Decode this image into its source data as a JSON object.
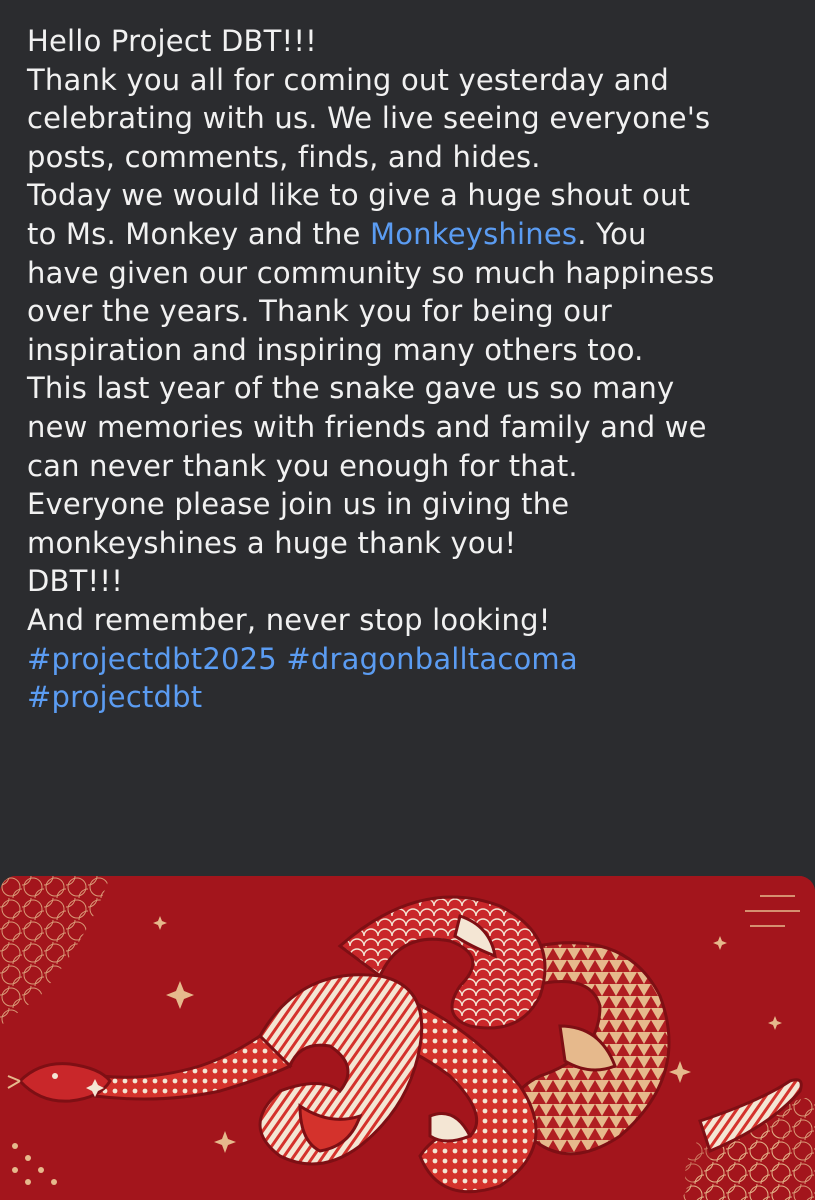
{
  "post": {
    "lines": [
      [
        {
          "text": "Hello Project DBT!!!"
        }
      ],
      [
        {
          "text": "Thank you all for coming out yesterday and"
        }
      ],
      [
        {
          "text": "celebrating with us. We live seeing everyone's"
        }
      ],
      [
        {
          "text": "posts, comments, finds, and hides."
        }
      ],
      [
        {
          "text": "Today we would like to give a huge shout out"
        }
      ],
      [
        {
          "text": "to Ms. Monkey and the "
        },
        {
          "text": "Monkeyshines",
          "link": true
        },
        {
          "text": ". You"
        }
      ],
      [
        {
          "text": "have given our community so much happiness"
        }
      ],
      [
        {
          "text": "over the years. Thank you for being our"
        }
      ],
      [
        {
          "text": "inspiration and inspiring many others too."
        }
      ],
      [
        {
          "text": "This last year of the snake gave us so many"
        }
      ],
      [
        {
          "text": "new memories with friends and family and we"
        }
      ],
      [
        {
          "text": "can never thank you enough for that."
        }
      ],
      [
        {
          "text": "Everyone please join us in giving the"
        }
      ],
      [
        {
          "text": "monkeyshines a huge thank you!"
        }
      ],
      [
        {
          "text": "DBT!!!"
        }
      ],
      [
        {
          "text": "And remember,  never stop looking!"
        }
      ],
      [
        {
          "text": "#projectdbt2025",
          "link": true
        },
        {
          "text": " "
        },
        {
          "text": "#dragonballtacoma",
          "link": true
        }
      ],
      [
        {
          "text": "#projectdbt",
          "link": true
        }
      ]
    ]
  },
  "image": {
    "icon": "snake-illustration",
    "colors": {
      "background": "#a3151c",
      "gold": "#e6b98c",
      "cream": "#f4e6d4",
      "dark_red": "#7e0f14",
      "bright_red": "#d4322c"
    }
  },
  "colors": {
    "page_background": "#2b2c2f",
    "text": "#f1f1f1",
    "link": "#5b9cf2"
  }
}
